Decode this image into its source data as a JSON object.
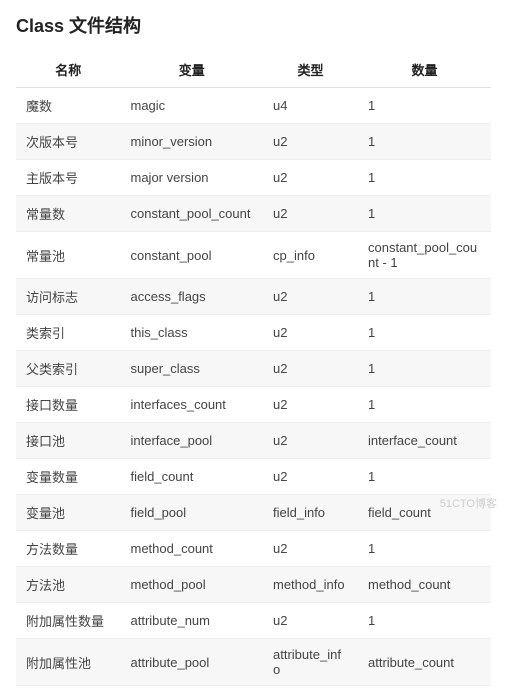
{
  "title": "Class 文件结构",
  "columns": [
    "名称",
    "变量",
    "类型",
    "数量"
  ],
  "rows": [
    {
      "name": "魔数",
      "variable": "magic",
      "type": "u4",
      "count": "1"
    },
    {
      "name": "次版本号",
      "variable": "minor_version",
      "type": "u2",
      "count": "1"
    },
    {
      "name": "主版本号",
      "variable": "major version",
      "type": "u2",
      "count": "1"
    },
    {
      "name": "常量数",
      "variable": "constant_pool_count",
      "type": "u2",
      "count": "1"
    },
    {
      "name": "常量池",
      "variable": "constant_pool",
      "type": "cp_info",
      "count": "constant_pool_count - 1"
    },
    {
      "name": "访问标志",
      "variable": "access_flags",
      "type": "u2",
      "count": "1"
    },
    {
      "name": "类索引",
      "variable": "this_class",
      "type": "u2",
      "count": "1"
    },
    {
      "name": "父类索引",
      "variable": "super_class",
      "type": "u2",
      "count": "1"
    },
    {
      "name": "接口数量",
      "variable": "interfaces_count",
      "type": "u2",
      "count": "1"
    },
    {
      "name": "接口池",
      "variable": "interface_pool",
      "type": "u2",
      "count": "interface_count"
    },
    {
      "name": "变量数量",
      "variable": "field_count",
      "type": "u2",
      "count": "1"
    },
    {
      "name": "变量池",
      "variable": "field_pool",
      "type": "field_info",
      "count": "field_count"
    },
    {
      "name": "方法数量",
      "variable": "method_count",
      "type": "u2",
      "count": "1"
    },
    {
      "name": "方法池",
      "variable": "method_pool",
      "type": "method_info",
      "count": "method_count"
    },
    {
      "name": "附加属性数量",
      "variable": "attribute_num",
      "type": "u2",
      "count": "1"
    },
    {
      "name": "附加属性池",
      "variable": "attribute_pool",
      "type": "attribute_info",
      "count": "attribute_count"
    }
  ],
  "watermark": "51CTO博客"
}
